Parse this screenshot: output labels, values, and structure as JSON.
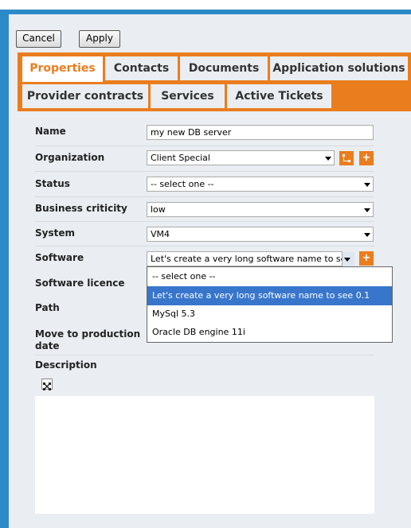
{
  "toolbar": {
    "cancel_label": "Cancel",
    "apply_label": "Apply"
  },
  "tabs": {
    "row1": [
      "Properties",
      "Contacts",
      "Documents",
      "Application solutions"
    ],
    "row2": [
      "Provider contracts",
      "Services",
      "Active Tickets"
    ]
  },
  "form": {
    "name_label": "Name",
    "name_value": "my new DB server",
    "organization_label": "Organization",
    "organization_value": "Client Special",
    "status_label": "Status",
    "status_value": "-- select one --",
    "criticity_label": "Business criticity",
    "criticity_value": "low",
    "system_label": "System",
    "system_value": "VM4",
    "software_label": "Software",
    "software_value": "Let's create a very long software name to see 0.1",
    "licence_label": "Software licence",
    "path_label": "Path",
    "production_label": "Move to production date",
    "description_label": "Description"
  },
  "software_dropdown": {
    "options": [
      "-- select one --",
      "Let's create a very long software name to see 0.1",
      "MySql 5.3",
      "Oracle DB engine 11i"
    ],
    "selected_index": 1
  },
  "colors": {
    "accent": "#ea7d1e",
    "frame": "#2d8ac8",
    "highlight": "#3876cc"
  }
}
